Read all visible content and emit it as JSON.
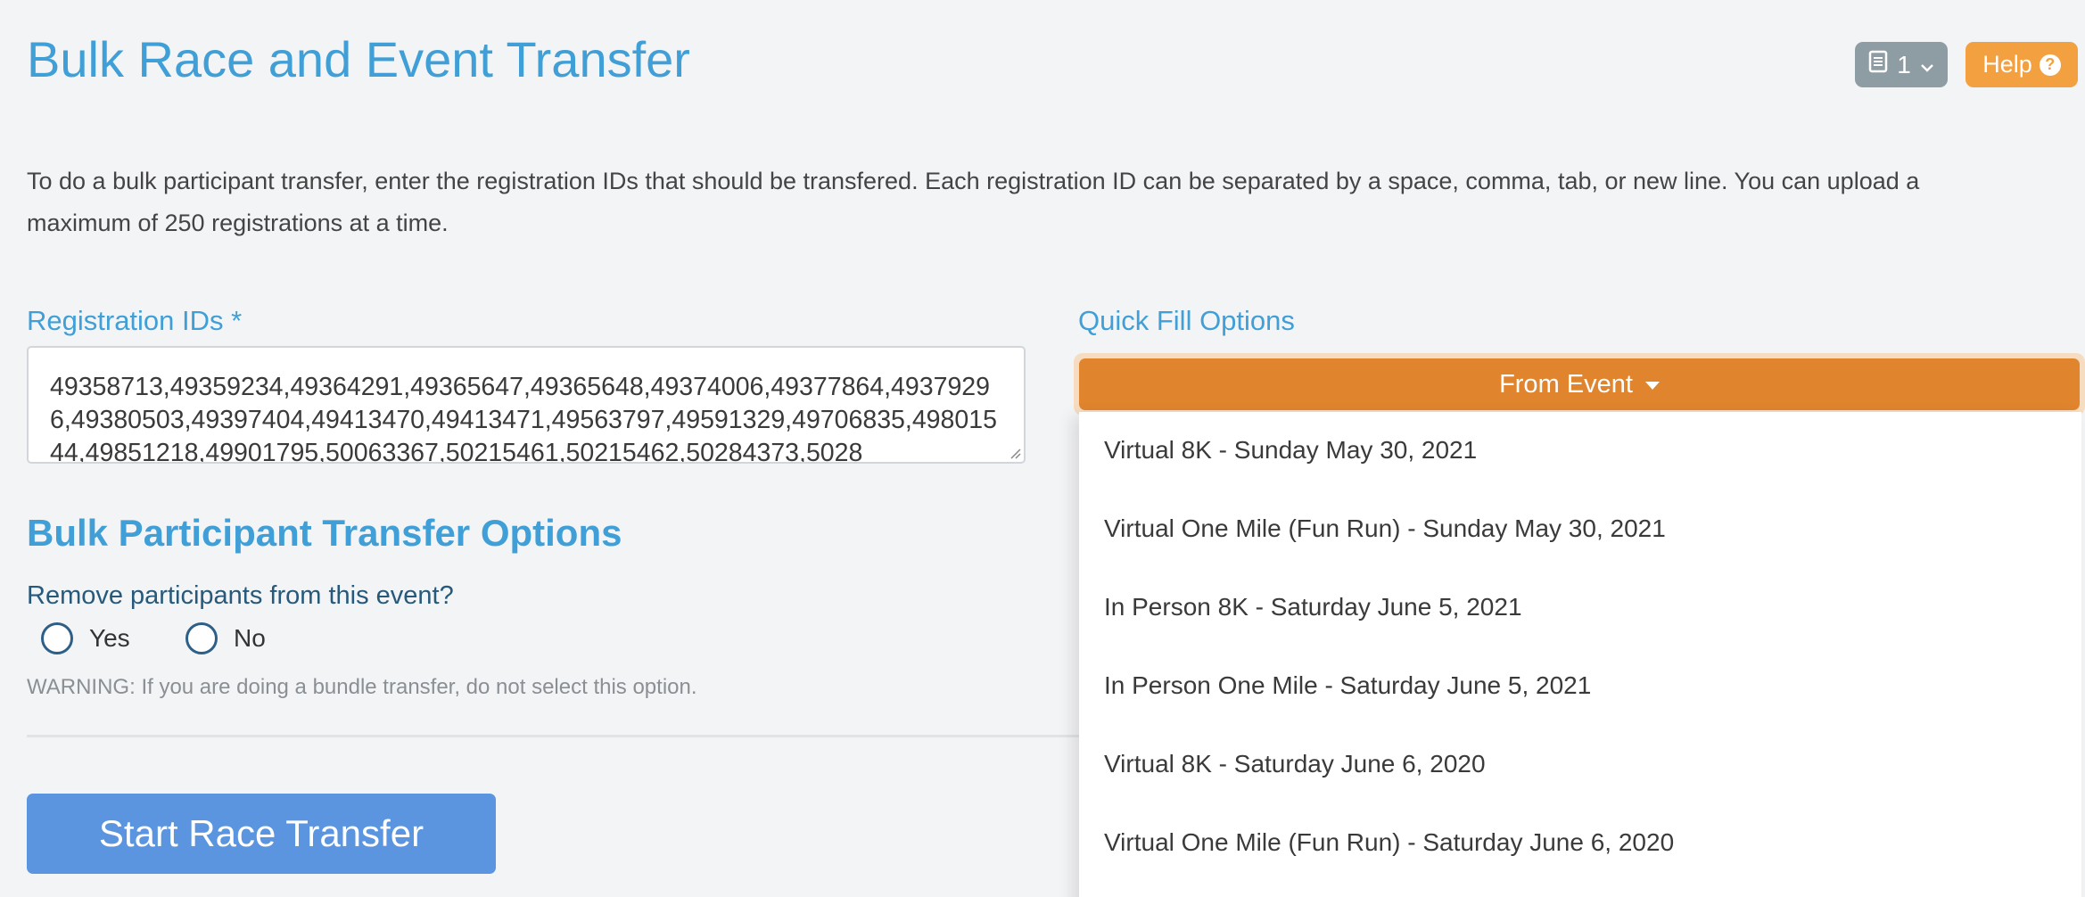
{
  "header": {
    "title": "Bulk Race and Event Transfer",
    "doc_count": "1",
    "help_label": "Help"
  },
  "intro": {
    "text": "To do a bulk participant transfer, enter the registration IDs that should be transfered. Each registration ID can be separated by a space, comma, tab, or new line. You can upload a maximum of 250 registrations at a time."
  },
  "registration": {
    "label": "Registration IDs *",
    "value": "49358713,49359234,49364291,49365647,49365648,49374006,49377864,49379296,49380503,49397404,49413470,49413471,49563797,49591329,49706835,49801544,49851218,49901795,50063367,50215461,50215462,50284373,5028"
  },
  "quick_fill": {
    "label": "Quick Fill Options",
    "button_label": "From Event",
    "items": [
      "Virtual 8K - Sunday May 30, 2021",
      "Virtual One Mile (Fun Run) - Sunday May 30, 2021",
      "In Person 8K - Saturday June 5, 2021",
      "In Person One Mile - Saturday June 5, 2021",
      "Virtual 8K - Saturday June 6, 2020",
      "Virtual One Mile (Fun Run) - Saturday June 6, 2020"
    ]
  },
  "options": {
    "section_title": "Bulk Participant Transfer Options",
    "question": "Remove participants from this event?",
    "yes_label": "Yes",
    "no_label": "No",
    "warning": "WARNING: If you are doing a bundle transfer, do not select this option."
  },
  "actions": {
    "start_label": "Start Race Transfer"
  },
  "colors": {
    "accent_blue": "#3f9fd6",
    "from_event_orange": "#e0842e",
    "help_orange": "#f2a040",
    "start_button_blue": "#5b95df"
  }
}
